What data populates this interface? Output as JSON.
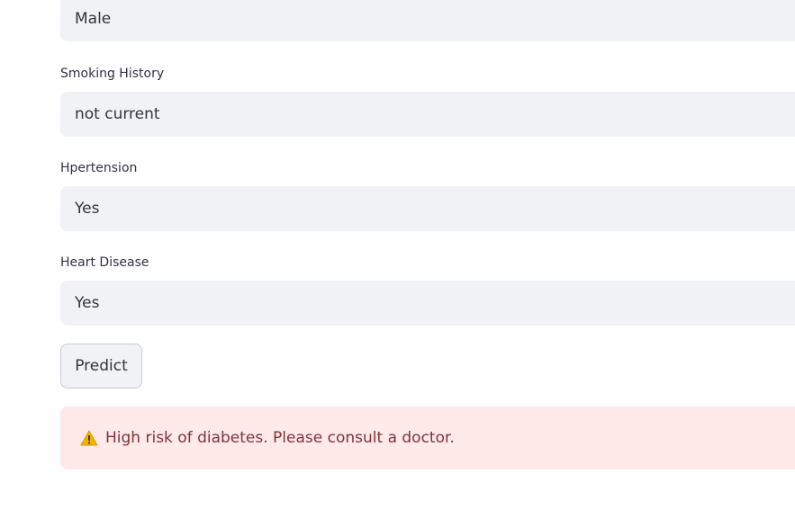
{
  "fields": {
    "gender": {
      "value": "Male"
    },
    "smoking_history": {
      "label": "Smoking History",
      "value": "not current"
    },
    "hypertension": {
      "label": "Hpertension",
      "value": "Yes"
    },
    "heart_disease": {
      "label": "Heart Disease",
      "value": "Yes"
    }
  },
  "predict_button": {
    "label": "Predict"
  },
  "alert": {
    "icon": "warning-icon",
    "message": "High risk of diabetes. Please consult a doctor.",
    "background": "#ffe9e9",
    "text_color": "#7d353b"
  },
  "colors": {
    "input_background": "#f0f2f6",
    "text": "#31333f"
  }
}
